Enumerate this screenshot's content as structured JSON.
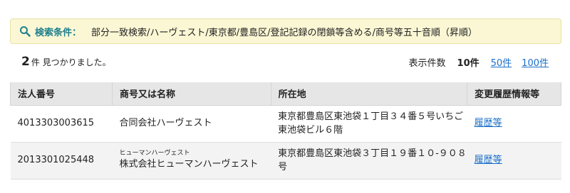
{
  "search_criteria": {
    "label": "検索条件：",
    "value": "部分一致検索/ハーヴェスト/東京都/豊島区/登記記録の閉鎖等含める/商号等五十音順（昇順）",
    "icon": "magnifier-icon",
    "colors": {
      "accent": "#1e7f8e",
      "background": "#fbf7d4"
    }
  },
  "result_summary": {
    "count": "2",
    "count_suffix": "件 見つかりました。"
  },
  "per_page": {
    "label": "表示件数",
    "current": "10件",
    "options": [
      "50件",
      "100件"
    ]
  },
  "table": {
    "headers": [
      "法人番号",
      "商号又は名称",
      "所在地",
      "変更履歴情報等"
    ],
    "rows": [
      {
        "corporate_number": "4013303003615",
        "furigana": "",
        "name": "合同会社ハーヴェスト",
        "address": "東京都豊島区東池袋１丁目３４番５号いちご東池袋ビル６階",
        "history_link": "履歴等"
      },
      {
        "corporate_number": "2013301025448",
        "furigana": "ヒューマンハーヴェスト",
        "name": "株式会社ヒューマンハーヴェスト",
        "address": "東京都豊島区東池袋３丁目１９番１０-９０８号",
        "history_link": "履歴等"
      }
    ]
  },
  "colors": {
    "link": "#1a6fc8",
    "header_bg": "#e6e6e6"
  }
}
